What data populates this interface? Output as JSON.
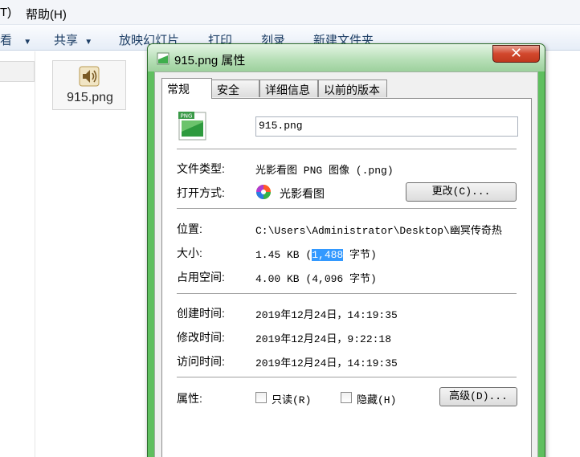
{
  "explorer": {
    "menu": {
      "tools_fragment": "T)",
      "help": "帮助(H)"
    },
    "toolbar": {
      "view_fragment": "看",
      "share": "共享",
      "slideshow": "放映幻灯片",
      "print": "打印",
      "burn": "刻录",
      "new_folder": "新建文件夹"
    },
    "file_item": {
      "name": "915.png",
      "icon": "speaker-icon"
    }
  },
  "dialog": {
    "title": "915.png 属性",
    "close_glyph": "✕",
    "tabs": [
      {
        "label": "常规",
        "active": true
      },
      {
        "label": "安全",
        "active": false
      },
      {
        "label": "详细信息",
        "active": false
      },
      {
        "label": "以前的版本",
        "active": false
      }
    ],
    "file_icon_badge": "PNG",
    "filename": "915.png",
    "file_type_label": "文件类型:",
    "file_type_value": "光影看图 PNG 图像 (.png)",
    "open_with_label": "打开方式:",
    "open_with_value": "光影看图",
    "change_button": "更改(C)...",
    "location_label": "位置:",
    "location_value": "C:\\Users\\Administrator\\Desktop\\幽冥传奇热",
    "size_label": "大小:",
    "size_prefix": "1.45 KB (",
    "size_bytes_selected": "1,488",
    "size_suffix": " 字节)",
    "size_on_disk_label": "占用空间:",
    "size_on_disk_value": "4.00 KB (4,096 字节)",
    "created_label": "创建时间:",
    "created_value": "2019年12月24日，14:19:35",
    "modified_label": "修改时间:",
    "modified_value": "2019年12月24日，9:22:18",
    "accessed_label": "访问时间:",
    "accessed_value": "2019年12月24日，14:19:35",
    "attributes_label": "属性:",
    "readonly_label": "只读(R)",
    "readonly_checked": false,
    "hidden_label": "隐藏(H)",
    "hidden_checked": false,
    "advanced_button": "高级(D)..."
  }
}
